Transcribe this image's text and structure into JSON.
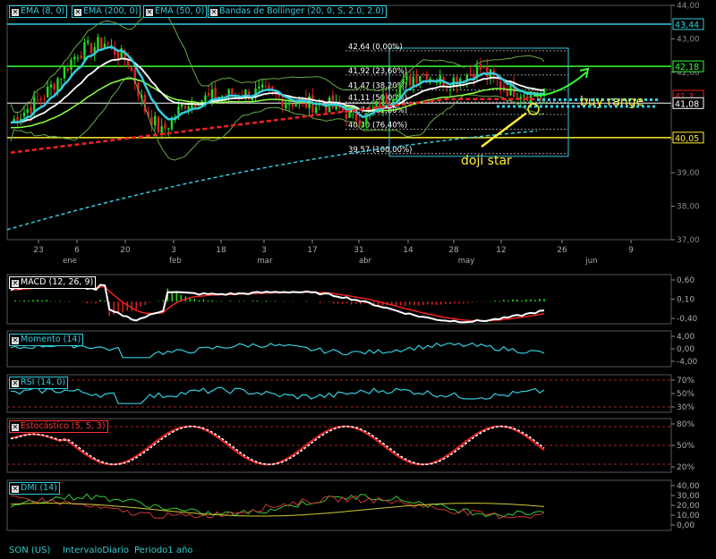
{
  "footer": {
    "symbol": "SON (US)",
    "interval": "IntervaloDiario",
    "period": "Periodo1 año"
  },
  "main_legend": [
    {
      "label": "EMA (8, 0)",
      "color": "#33ccdd"
    },
    {
      "label": "EMA (200, 0)",
      "color": "#33ccdd"
    },
    {
      "label": "EMA (50, 0)",
      "color": "#33ccdd"
    },
    {
      "label": "Bandas de Bollinger (20, 0, S, 2.0, 2.0)",
      "color": "#33ccdd"
    }
  ],
  "sub_legend": {
    "macd": {
      "label": "MACD (12, 26, 9)",
      "color": "#ffffff"
    },
    "momentum": {
      "label": "Momento (14)",
      "color": "#33ccdd"
    },
    "rsi": {
      "label": "RSI (14, 0)",
      "color": "#33ccdd"
    },
    "stoch": {
      "label": "Estocástico (5, 5, 3)",
      "color": "#ff3333"
    },
    "dmi": {
      "label": "DMI (14)",
      "color": "#33ccdd"
    }
  },
  "colors": {
    "up": "#22dd22",
    "down": "#dd2222",
    "cyan": "#33ccdd",
    "yellow": "#ffee33",
    "green_line": "#33ff33"
  },
  "chart_data": [
    {
      "type": "candlestick",
      "ylim": [
        37.0,
        44.0
      ],
      "y_ticks": [
        "44,00",
        "43,00",
        "42,00",
        "41,00",
        "40,00",
        "39,00",
        "38,00",
        "37,00"
      ],
      "x_day_ticks": [
        "23",
        "6",
        "20",
        "3",
        "18",
        "3",
        "17",
        "31",
        "14",
        "28",
        "12",
        "26",
        "9"
      ],
      "x_month_labels": [
        "ene",
        "feb",
        "mar",
        "abr",
        "may",
        "jun"
      ],
      "price_tags": [
        {
          "value": 43.44,
          "text": "43,44",
          "color": "#33ccdd"
        },
        {
          "value": 42.18,
          "text": "42,18",
          "color": "#33ff33"
        },
        {
          "value": 41.3,
          "text": "41,3",
          "color": "#dd2222"
        },
        {
          "value": 41.08,
          "text": "41,08",
          "color": "#ffffff"
        },
        {
          "value": 40.05,
          "text": "40,05",
          "color": "#ffee33"
        }
      ],
      "fibonacci": [
        {
          "value": 42.64,
          "text": "42,64  (0,00%)"
        },
        {
          "value": 41.92,
          "text": "41,92  (23,60%)"
        },
        {
          "value": 41.47,
          "text": "41,47  (38,20%)"
        },
        {
          "value": 41.11,
          "text": "41,11  (50,00%)"
        },
        {
          "value": 40.74,
          "text": "40,74  (61,80%)"
        },
        {
          "value": 40.3,
          "text": "40,30  (76,40%)"
        },
        {
          "value": 39.57,
          "text": "39,57  (100,00%)"
        }
      ],
      "annotations": [
        {
          "text": "doji star",
          "color": "#ffee33"
        },
        {
          "text": "buy range",
          "color": "#ffee33"
        }
      ]
    },
    {
      "type": "line",
      "name": "MACD",
      "y_ticks": [
        "0,60",
        "0,10",
        "-0,40"
      ]
    },
    {
      "type": "line",
      "name": "Momento",
      "y_ticks": [
        "4,00",
        "0,00",
        "-4,00"
      ]
    },
    {
      "type": "line",
      "name": "RSI",
      "y_ticks": [
        "70%",
        "50%",
        "30%"
      ]
    },
    {
      "type": "line",
      "name": "Estocástico",
      "y_ticks": [
        "80%",
        "50%",
        "20%"
      ]
    },
    {
      "type": "line",
      "name": "DMI",
      "y_ticks": [
        "40,00",
        "30,00",
        "20,00",
        "10,00",
        "0,00"
      ]
    }
  ]
}
